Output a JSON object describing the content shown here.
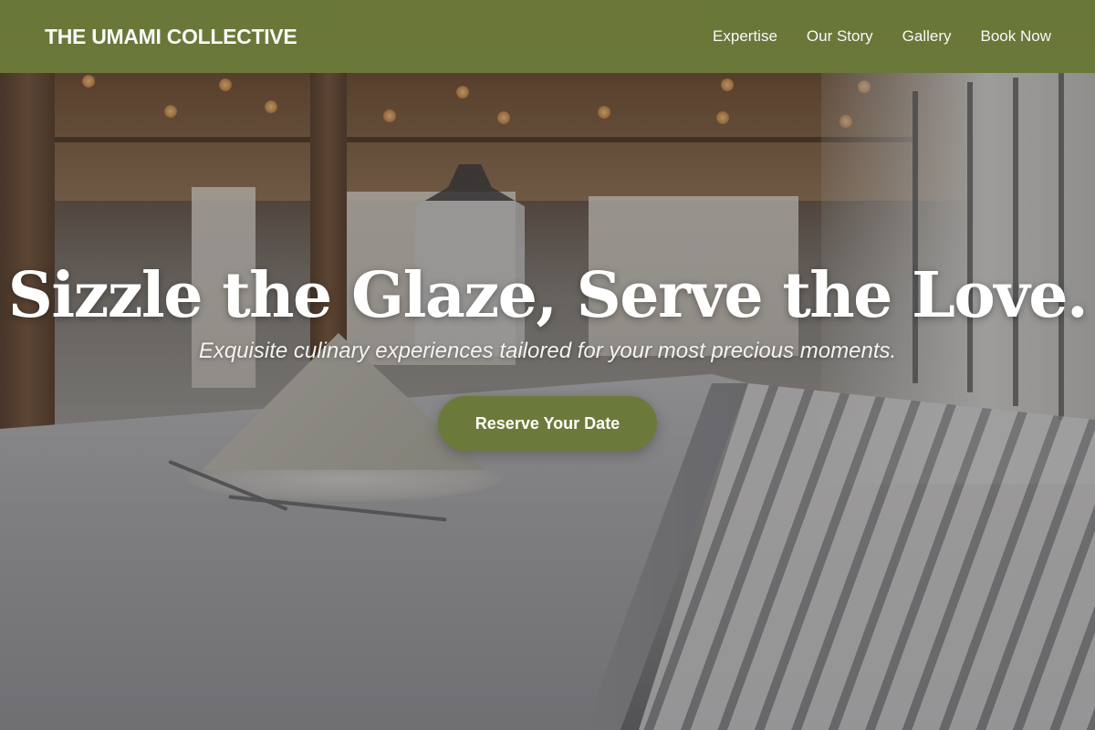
{
  "header": {
    "brand": "THE UMAMI COLLECTIVE",
    "nav": [
      {
        "label": "Expertise"
      },
      {
        "label": "Our Story"
      },
      {
        "label": "Gallery"
      },
      {
        "label": "Book Now"
      }
    ]
  },
  "hero": {
    "headline": "Sizzle the Glaze, Serve the Love.",
    "subheadline": "Exquisite culinary experiences tailored for your most precious moments.",
    "cta_label": "Reserve Your Date"
  },
  "colors": {
    "brand_olive": "#6b7a3a",
    "text_light": "#ffffff"
  }
}
